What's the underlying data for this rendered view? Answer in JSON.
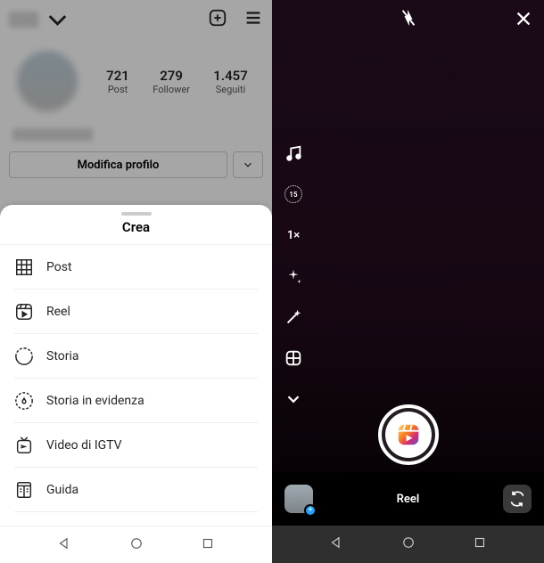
{
  "left": {
    "stats": {
      "posts": {
        "value": "721",
        "label": "Post"
      },
      "followers": {
        "value": "279",
        "label": "Follower"
      },
      "following": {
        "value": "1.457",
        "label": "Seguiti"
      }
    },
    "edit_profile": "Modifica profilo",
    "sheet": {
      "title": "Crea",
      "items": [
        {
          "label": "Post"
        },
        {
          "label": "Reel"
        },
        {
          "label": "Storia"
        },
        {
          "label": "Storia in evidenza"
        },
        {
          "label": "Video di IGTV"
        },
        {
          "label": "Guida"
        }
      ]
    }
  },
  "right": {
    "timer_value": "15",
    "speed_value": "1×",
    "mode_label": "Reel"
  }
}
